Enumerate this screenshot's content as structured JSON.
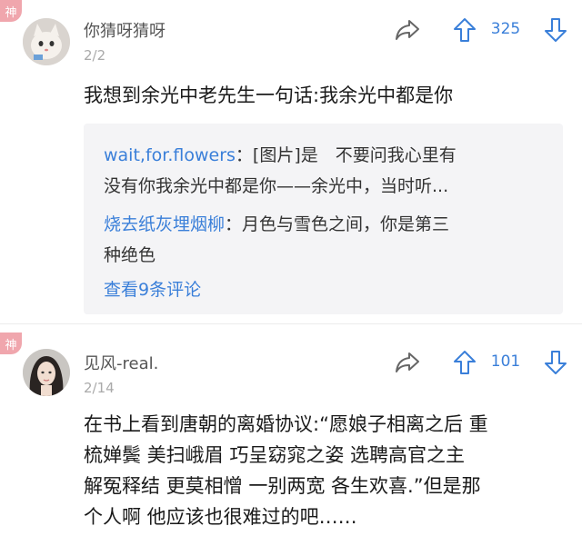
{
  "badge_label": "神",
  "posts": [
    {
      "username": "你猜呀猜呀",
      "floor": "2/2",
      "upvotes": "325",
      "text": "我想到余光中老先生一句话:我余光中都是你",
      "replies": [
        {
          "name": "wait,for.flowers",
          "sep": "：",
          "text_l1": "[图片]是　不要问我心里有",
          "text_l2": "没有你我余光中都是你——余光中，当时听..."
        },
        {
          "name": "烧去纸灰埋烟柳",
          "sep": "：",
          "text_l1": "月色与雪色之间，你是第三",
          "text_l2": "种绝色"
        }
      ],
      "more_label": "查看9条评论"
    },
    {
      "username": "见风-real.",
      "floor": "2/14",
      "upvotes": "101",
      "text_lines": [
        "在书上看到唐朝的离婚协议:“愿娘子相离之后 重",
        "梳婵鬓 美扫峨眉 巧呈窈窕之姿 选聘高官之主",
        "解冤释结 更莫相憎 一别两宽 各生欢喜.”但是那",
        "个人啊 他应该也很难过的吧……"
      ]
    }
  ],
  "icons": {
    "share": "share-arrow-icon",
    "upvote": "upvote-arrow-icon",
    "downvote": "downvote-arrow-icon"
  },
  "colors": {
    "accent": "#3a7fd9",
    "badge": "#f0a6ad"
  }
}
